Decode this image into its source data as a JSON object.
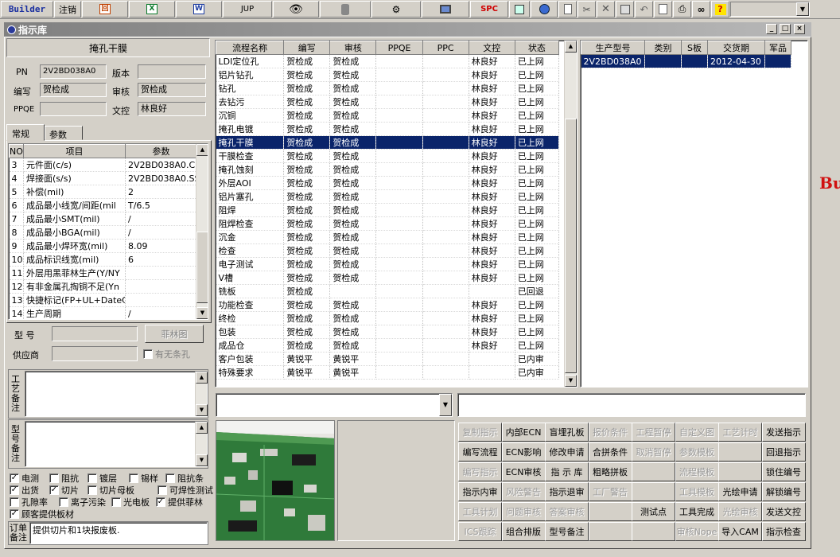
{
  "toolbar": {
    "app_label": "Builder",
    "logout_label": "注销",
    "icon_labels": [
      "回",
      "X",
      "W",
      "JUP",
      "",
      "",
      "",
      "",
      "SPC",
      "",
      "",
      "",
      "",
      "",
      "",
      "",
      "",
      "",
      "",
      "?"
    ]
  },
  "window": {
    "title": "指示库",
    "min": "_",
    "max": "□",
    "close": "×"
  },
  "left": {
    "title": "掩孔干膜",
    "pn_label": "PN",
    "pn_value": "2V2BD038A0",
    "version_label": "版本",
    "version_value": "",
    "editor_label": "编写",
    "editor_value": "贺检成",
    "review_label": "审核",
    "review_value": "贺检成",
    "ppqe_label": "PPQE",
    "ppqe_value": "",
    "control_label": "文控",
    "control_value": "林良好",
    "tabs": [
      "常规",
      "参数"
    ],
    "params_headers": [
      "NO",
      "项目",
      "参数"
    ],
    "params": [
      {
        "no": "3",
        "item": "元件面(c/s)",
        "value": "2V2BD038A0.CS"
      },
      {
        "no": "4",
        "item": "焊接面(s/s)",
        "value": "2V2BD038A0.SS"
      },
      {
        "no": "5",
        "item": "补偿(mil)",
        "value": "2"
      },
      {
        "no": "6",
        "item": "成品最小线宽/间距(mil",
        "value": "T/6.5"
      },
      {
        "no": "7",
        "item": "成品最小SMT(mil)",
        "value": "/"
      },
      {
        "no": "8",
        "item": "成品最小BGA(mil)",
        "value": "/"
      },
      {
        "no": "9",
        "item": "成品最小焊环宽(mil)",
        "value": "8.09"
      },
      {
        "no": "10",
        "item": "成品标识线宽(mil)",
        "value": "6"
      },
      {
        "no": "11",
        "item": "外层用黑菲林生产(Y/NY",
        "value": ""
      },
      {
        "no": "12",
        "item": "有非金属孔掏铜不足(Yn",
        "value": ""
      },
      {
        "no": "13",
        "item": "快捷标记(FP+UL+DateC/",
        "value": ""
      },
      {
        "no": "14",
        "item": "生产周期",
        "value": "/"
      }
    ],
    "model_label": "型  号",
    "model_value": "",
    "film_button": "菲林图",
    "supplier_label": "供应商",
    "supplier_value": "",
    "strip_label": "有无条孔",
    "process_note_label": "工艺备注",
    "model_note_label": "型号备注",
    "checkboxes_row1": [
      {
        "label": "电测",
        "checked": true
      },
      {
        "label": "阻抗",
        "checked": false
      },
      {
        "label": "镀层",
        "checked": false
      },
      {
        "label": "锡样",
        "checked": false
      },
      {
        "label": "阻抗条",
        "checked": false
      }
    ],
    "checkboxes_row2": [
      {
        "label": "出货",
        "checked": true
      },
      {
        "label": "切片",
        "checked": true
      },
      {
        "label": "切片母板",
        "checked": false
      },
      {
        "label": "可焊性测试",
        "checked": false
      }
    ],
    "checkboxes_row3": [
      {
        "label": "孔隙率",
        "checked": false
      },
      {
        "label": "离子污染",
        "checked": false
      },
      {
        "label": "光电板",
        "checked": false
      },
      {
        "label": "提供菲林",
        "checked": true
      }
    ],
    "checkboxes_row4": [
      {
        "label": "顾客提供板材",
        "checked": true
      }
    ],
    "order_note_label": "订单备注",
    "order_note_value": "提供切片和1块报废板."
  },
  "flow": {
    "headers": [
      "流程名称",
      "编写",
      "审核",
      "PPQE",
      "PPC",
      "文控",
      "状态"
    ],
    "rows": [
      [
        "LDI定位孔",
        "贺检成",
        "贺检成",
        "",
        "",
        "林良好",
        "已上网"
      ],
      [
        "铝片钻孔",
        "贺检成",
        "贺检成",
        "",
        "",
        "林良好",
        "已上网"
      ],
      [
        "钻孔",
        "贺检成",
        "贺检成",
        "",
        "",
        "林良好",
        "已上网"
      ],
      [
        "去钻污",
        "贺检成",
        "贺检成",
        "",
        "",
        "林良好",
        "已上网"
      ],
      [
        "沉铜",
        "贺检成",
        "贺检成",
        "",
        "",
        "林良好",
        "已上网"
      ],
      [
        "掩孔电镀",
        "贺检成",
        "贺检成",
        "",
        "",
        "林良好",
        "已上网"
      ],
      [
        "掩孔干膜",
        "贺检成",
        "贺检成",
        "",
        "",
        "林良好",
        "已上网"
      ],
      [
        "干膜检查",
        "贺检成",
        "贺检成",
        "",
        "",
        "林良好",
        "已上网"
      ],
      [
        "掩孔蚀刻",
        "贺检成",
        "贺检成",
        "",
        "",
        "林良好",
        "已上网"
      ],
      [
        "外层AOI",
        "贺检成",
        "贺检成",
        "",
        "",
        "林良好",
        "已上网"
      ],
      [
        "铝片塞孔",
        "贺检成",
        "贺检成",
        "",
        "",
        "林良好",
        "已上网"
      ],
      [
        "阻焊",
        "贺检成",
        "贺检成",
        "",
        "",
        "林良好",
        "已上网"
      ],
      [
        "阻焊检查",
        "贺检成",
        "贺检成",
        "",
        "",
        "林良好",
        "已上网"
      ],
      [
        "沉金",
        "贺检成",
        "贺检成",
        "",
        "",
        "林良好",
        "已上网"
      ],
      [
        "检查",
        "贺检成",
        "贺检成",
        "",
        "",
        "林良好",
        "已上网"
      ],
      [
        "电子测试",
        "贺检成",
        "贺检成",
        "",
        "",
        "林良好",
        "已上网"
      ],
      [
        "V槽",
        "贺检成",
        "贺检成",
        "",
        "",
        "林良好",
        "已上网"
      ],
      [
        "铣板",
        "贺检成",
        "",
        "",
        "",
        "",
        "已回退"
      ],
      [
        "功能检查",
        "贺检成",
        "贺检成",
        "",
        "",
        "林良好",
        "已上网"
      ],
      [
        "终检",
        "贺检成",
        "贺检成",
        "",
        "",
        "林良好",
        "已上网"
      ],
      [
        "包装",
        "贺检成",
        "贺检成",
        "",
        "",
        "林良好",
        "已上网"
      ],
      [
        "成品仓",
        "贺检成",
        "贺检成",
        "",
        "",
        "林良好",
        "已上网"
      ],
      [
        "客户包装",
        "黄锐平",
        "黄锐平",
        "",
        "",
        "",
        "已内审"
      ],
      [
        "特殊要求",
        "黄锐平",
        "黄锐平",
        "",
        "",
        "",
        "已内审"
      ]
    ],
    "selected_index": 6
  },
  "models": {
    "headers": [
      "生产型号",
      "类别",
      "S板",
      "交货期",
      "军品"
    ],
    "rows": [
      [
        "2V2BD038A0",
        "",
        "",
        "2012-04-30",
        ""
      ]
    ]
  },
  "right_edge_text": "Bu",
  "actions": [
    [
      "复制指示",
      "内部ECN",
      "盲埋孔板",
      "报价条件",
      "工程暂停",
      "自定义图",
      "工艺计时",
      "发送指示"
    ],
    [
      "编写流程",
      "ECN影响",
      "修改申请",
      "合拼条件",
      "取消暂停",
      "参数模板",
      "",
      "回退指示"
    ],
    [
      "编写指示",
      "ECN审核",
      "指 示 库",
      "粗略拼板",
      "",
      "流程模板",
      "",
      "锁住编号"
    ],
    [
      "指示内审",
      "风险警告",
      "指示退审",
      "工厂警告",
      "",
      "工具模板",
      "光绘申请",
      "解锁编号"
    ],
    [
      "工具计划",
      "问题审核",
      "答案审核",
      "",
      "测试点",
      "工具完成",
      "光绘审核",
      "发送文控"
    ],
    [
      "ICS跟踪",
      "组合排版",
      "型号备注",
      "",
      "",
      "审核Nope",
      "导入CAM",
      "指示检查"
    ]
  ],
  "actions_disabled": [
    [
      true,
      false,
      false,
      true,
      true,
      true,
      true,
      false
    ],
    [
      false,
      false,
      false,
      false,
      true,
      true,
      false,
      false
    ],
    [
      true,
      false,
      false,
      false,
      false,
      true,
      false,
      false
    ],
    [
      false,
      true,
      false,
      true,
      false,
      true,
      false,
      false
    ],
    [
      true,
      true,
      true,
      false,
      false,
      false,
      true,
      false
    ],
    [
      true,
      false,
      false,
      false,
      false,
      true,
      false,
      false
    ]
  ]
}
